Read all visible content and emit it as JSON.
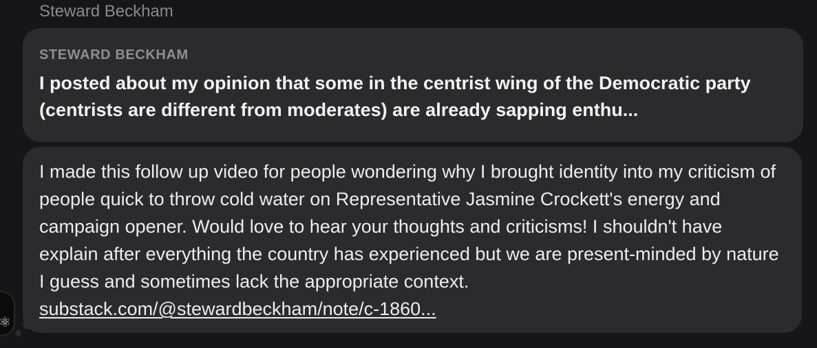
{
  "sender": {
    "name": "Steward Beckham"
  },
  "quote": {
    "author": "STEWARD BECKHAM",
    "text": "I posted about my opinion that some in the centrist wing of the Democratic party (centrists are different from moderates) are already sapping enthu..."
  },
  "message": {
    "text": "I made this follow up video for people wondering why I brought identity into my criticism of people quick to throw cold water on Representative Jasmine Crockett's energy and campaign opener. Would love to hear your thoughts and criticisms! I shouldn't have explain after everything the country has experienced but we are present-minded by nature I guess and sometimes lack the appropriate context. ",
    "link": "substack.com/@stewardbeckham/note/c-1860..."
  },
  "avatar": {
    "icon": "atom-icon"
  },
  "colors": {
    "background": "#161618",
    "bubble": "#2b2b2e",
    "text": "#ededf0",
    "muted": "#8a8a8e"
  }
}
